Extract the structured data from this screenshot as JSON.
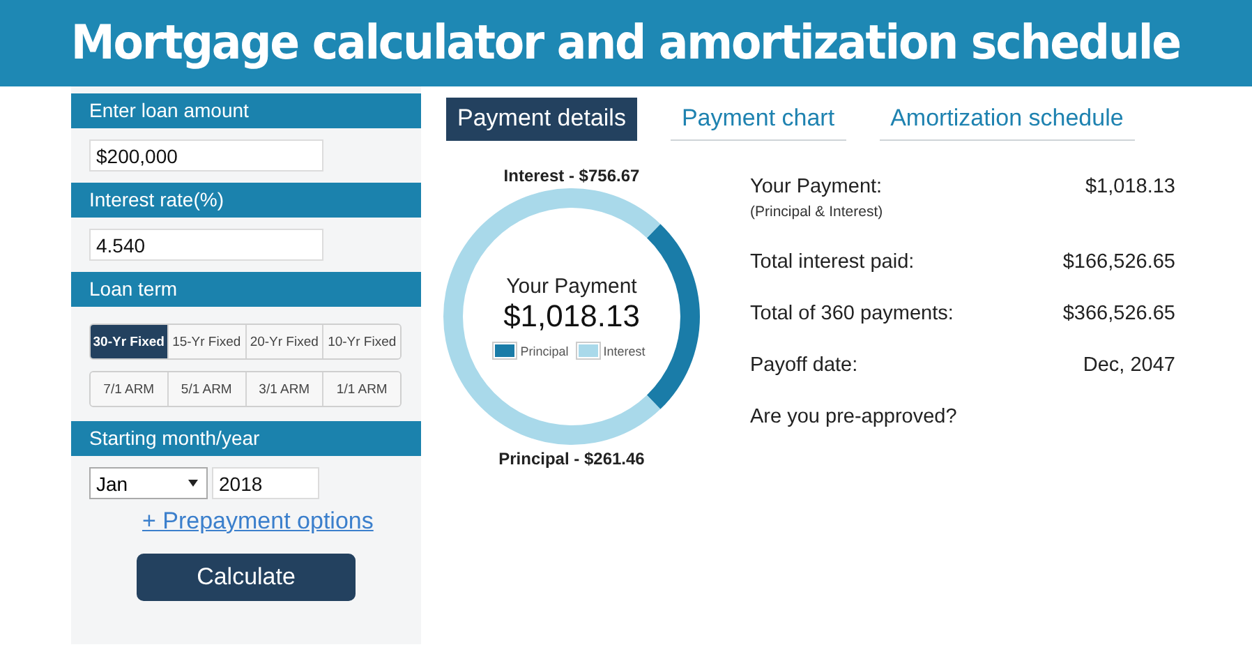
{
  "title": "Mortgage calculator and amortization schedule",
  "form": {
    "loan_amount": {
      "label": "Enter loan amount",
      "value": "$200,000"
    },
    "interest_rate": {
      "label": "Interest rate(%)",
      "value": "4.540"
    },
    "loan_term": {
      "label": "Loan term",
      "options": [
        {
          "label": "30-Yr Fixed",
          "selected": true
        },
        {
          "label": "15-Yr Fixed",
          "selected": false
        },
        {
          "label": "20-Yr Fixed",
          "selected": false
        },
        {
          "label": "10-Yr Fixed",
          "selected": false
        },
        {
          "label": "7/1 ARM",
          "selected": false
        },
        {
          "label": "5/1 ARM",
          "selected": false
        },
        {
          "label": "3/1 ARM",
          "selected": false
        },
        {
          "label": "1/1 ARM",
          "selected": false
        }
      ]
    },
    "start": {
      "label": "Starting month/year",
      "month": "Jan",
      "year": "2018"
    },
    "prepayment_link": "+ Prepayment options",
    "calculate_button": "Calculate"
  },
  "tabs": [
    {
      "label": "Payment details",
      "selected": true
    },
    {
      "label": "Payment chart",
      "selected": false
    },
    {
      "label": "Amortization schedule",
      "selected": false
    }
  ],
  "donut": {
    "top_label": "Interest - $756.67",
    "bottom_label": "Principal - $261.46",
    "center_title": "Your Payment",
    "center_value": "$1,018.13",
    "legend": [
      {
        "color": "#1a7ca8"
      },
      {
        "color": "#a9d9ea"
      }
    ],
    "chart_data": {
      "type": "donut",
      "categories": [
        "Principal",
        "Interest"
      ],
      "values": [
        25.68,
        74.32
      ],
      "legend": "center"
    }
  },
  "details": [
    {
      "label": "Your Payment:",
      "note": "(Principal & Interest)",
      "value": "$1,018.13"
    },
    {
      "label": "Total interest paid:",
      "value": "$166,526.65"
    },
    {
      "label": "Total of 360 payments:",
      "value": "$366,526.65"
    },
    {
      "label": "Payoff date:",
      "value": "Dec, 2047"
    },
    {
      "label": "Are you pre-approved?"
    }
  ]
}
